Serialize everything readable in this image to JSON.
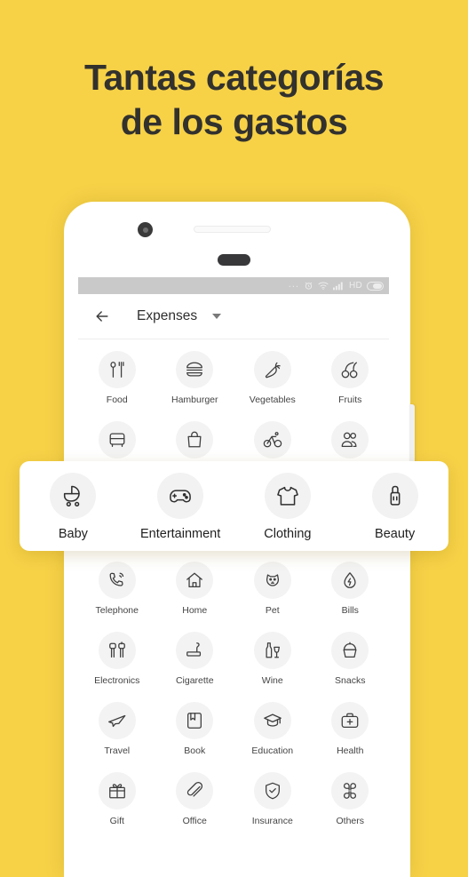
{
  "headline": {
    "line1": "Tantas categorías",
    "line2": "de los gastos"
  },
  "colors": {
    "background": "#F7D247",
    "headline_text": "#32312E",
    "phone_body": "#FFFFFF",
    "status_bar": "#C9C9C9",
    "icon_circle": "#F3F3F3",
    "icon_stroke": "#3E3E3E"
  },
  "phone": {
    "status_bar": {
      "dots": "...",
      "hd_label": "HD",
      "icons": [
        "alarm-clock-icon",
        "wifi-icon",
        "signal-icon",
        "battery-icon"
      ]
    },
    "appbar": {
      "back_icon": "back-arrow-icon",
      "title": "Expenses",
      "caret_icon": "chevron-down-icon"
    }
  },
  "grid": {
    "rows": [
      [
        {
          "label": "Food",
          "icon": "spoon-fork-icon"
        },
        {
          "label": "Hamburger",
          "icon": "hamburger-icon"
        },
        {
          "label": "Vegetables",
          "icon": "carrot-icon"
        },
        {
          "label": "Fruits",
          "icon": "cherries-icon"
        }
      ],
      [
        {
          "label": "",
          "icon": "bus-icon"
        },
        {
          "label": "",
          "icon": "shopping-bag-icon"
        },
        {
          "label": "",
          "icon": "bicycle-icon"
        },
        {
          "label": "",
          "icon": "people-icon"
        }
      ],
      [
        {
          "label": "",
          "icon": "stroller-icon"
        },
        {
          "label": "",
          "icon": "gamepad-icon"
        },
        {
          "label": "",
          "icon": "tshirt-icon"
        },
        {
          "label": "",
          "icon": "lipstick-icon"
        }
      ],
      [
        {
          "label": "Telephone",
          "icon": "telephone-icon"
        },
        {
          "label": "Home",
          "icon": "home-icon"
        },
        {
          "label": "Pet",
          "icon": "dog-icon"
        },
        {
          "label": "Bills",
          "icon": "water-drop-icon"
        }
      ],
      [
        {
          "label": "Electronics",
          "icon": "plug-icon"
        },
        {
          "label": "Cigarette",
          "icon": "cigarette-icon"
        },
        {
          "label": "Wine",
          "icon": "wine-icon"
        },
        {
          "label": "Snacks",
          "icon": "cupcake-icon"
        }
      ],
      [
        {
          "label": "Travel",
          "icon": "airplane-icon"
        },
        {
          "label": "Book",
          "icon": "book-icon"
        },
        {
          "label": "Education",
          "icon": "graduation-cap-icon"
        },
        {
          "label": "Health",
          "icon": "medical-kit-icon"
        }
      ],
      [
        {
          "label": "Gift",
          "icon": "gift-icon"
        },
        {
          "label": "Office",
          "icon": "paperclip-icon"
        },
        {
          "label": "Insurance",
          "icon": "shield-check-icon"
        },
        {
          "label": "Others",
          "icon": "four-petals-icon"
        }
      ]
    ]
  },
  "highlight_card": {
    "items": [
      {
        "label": "Baby",
        "icon": "stroller-icon"
      },
      {
        "label": "Entertainment",
        "icon": "gamepad-icon"
      },
      {
        "label": "Clothing",
        "icon": "tshirt-icon"
      },
      {
        "label": "Beauty",
        "icon": "lipstick-icon"
      }
    ]
  }
}
